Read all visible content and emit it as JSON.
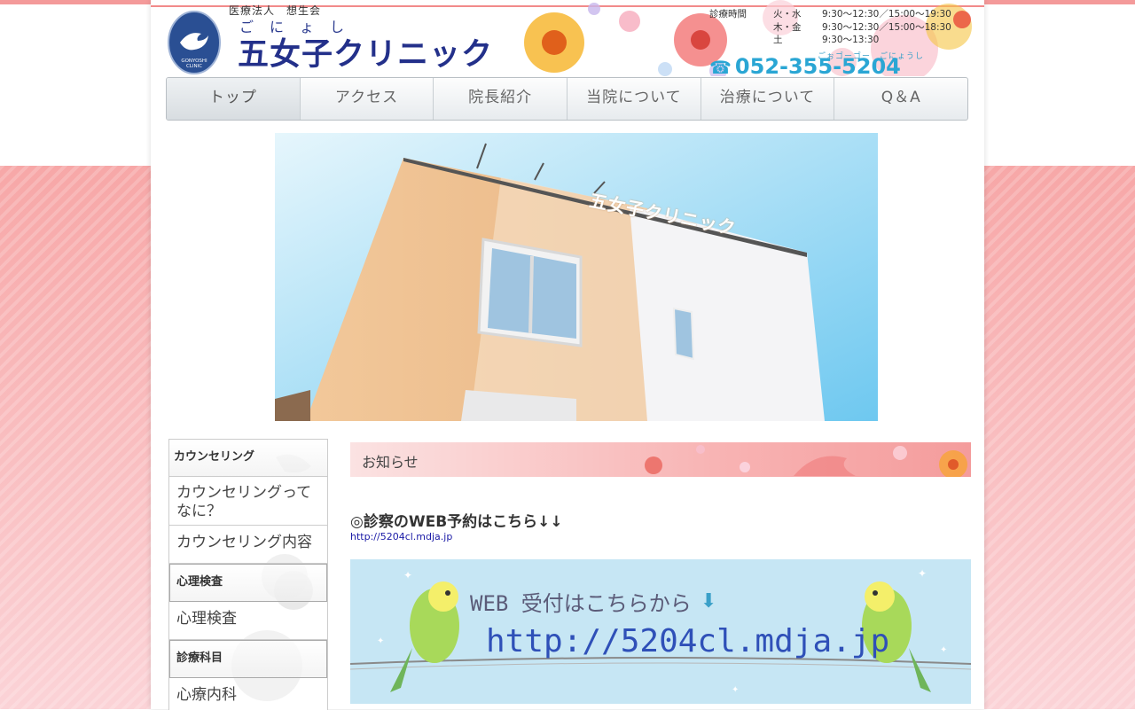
{
  "header": {
    "corp_name": "医療法人　想生会",
    "clinic_ruby": "ごにょし",
    "clinic_name": "五女子クリニック",
    "logo_text": "GONYOSHI CLINIC",
    "hours_label": "診療時間",
    "hours": [
      {
        "days": "火・水",
        "time": "9:30～12:30／15:00～19:30"
      },
      {
        "days": "木・金",
        "time": "9:30～12:30／15:00～18:30"
      },
      {
        "days": "土",
        "time": "9:30～13:30"
      }
    ],
    "tel_kana": "ごぉゴーゴー　ごにょうし",
    "tel": "052-355-5204",
    "tel_icon": "phone-icon"
  },
  "nav": {
    "items": [
      {
        "label": "トップ"
      },
      {
        "label": "アクセス"
      },
      {
        "label": "院長紹介"
      },
      {
        "label": "当院について"
      },
      {
        "label": "治療について"
      },
      {
        "label": "Q＆A"
      }
    ]
  },
  "hero": {
    "building_sign": "五女子クリニック"
  },
  "sidebar": {
    "sections": [
      {
        "heading": "カウンセリング",
        "items": [
          "カウンセリングってなに？",
          "カウンセリング内容"
        ]
      },
      {
        "heading": "心理検査",
        "items": [
          "心理検査"
        ]
      },
      {
        "heading": "診療科目",
        "items": [
          "心療内科"
        ]
      }
    ]
  },
  "main": {
    "news_title": "お知らせ",
    "web_title": "◎診察のWEB予約はこちら↓↓",
    "web_link": "http://5204cl.mdja.jp",
    "banner_line1": "WEB 受付はこちらから",
    "banner_line2": "http://5204cl.mdja.jp"
  },
  "colors": {
    "brand_navy": "#23308a",
    "tel_blue": "#2aa6d4",
    "pink": "#f49a9a"
  }
}
